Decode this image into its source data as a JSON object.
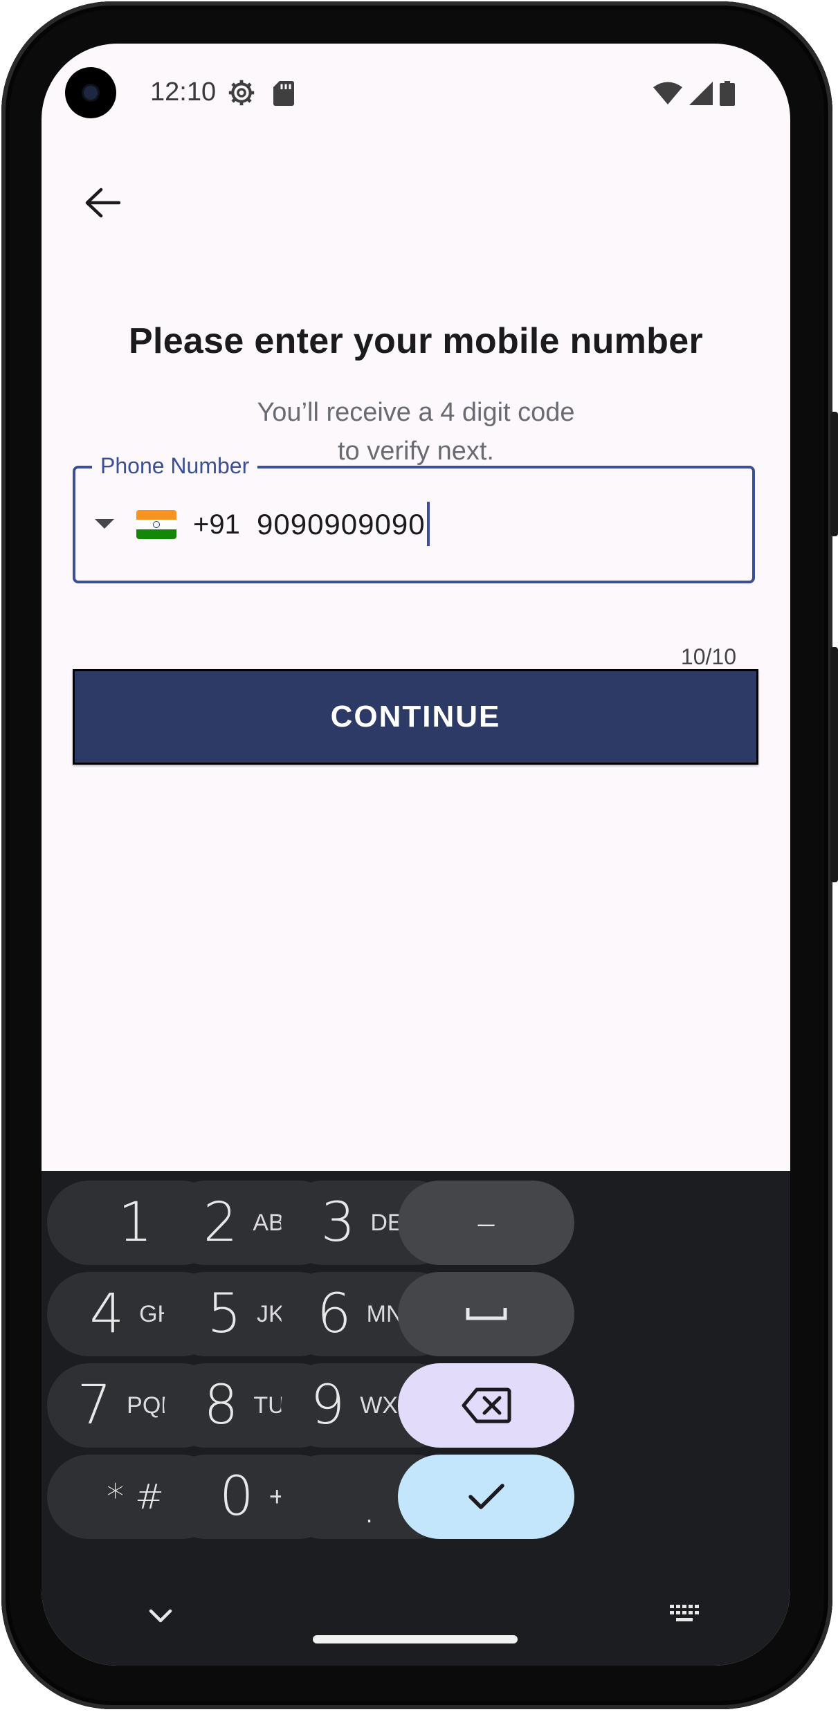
{
  "status_bar": {
    "time": "12:10"
  },
  "header": {
    "title": "Please enter your mobile number",
    "subtitle_line1": "You’ll receive a 4 digit code",
    "subtitle_line2": "to verify next."
  },
  "phone_field": {
    "label": "Phone Number",
    "dial_code": "+91",
    "value": "9090909090",
    "counter": "10/10"
  },
  "continue_button": {
    "label": "CONTINUE"
  },
  "keyboard": {
    "keys": [
      {
        "num": "1",
        "letters": ""
      },
      {
        "num": "2",
        "letters": "ABC"
      },
      {
        "num": "3",
        "letters": "DEF"
      },
      {
        "num": "4",
        "letters": "GHI"
      },
      {
        "num": "5",
        "letters": "JKL"
      },
      {
        "num": "6",
        "letters": "MNO"
      },
      {
        "num": "7",
        "letters": "PQRS"
      },
      {
        "num": "8",
        "letters": "TUV"
      },
      {
        "num": "9",
        "letters": "WXYZ"
      },
      {
        "num": "* #",
        "letters": ""
      },
      {
        "num": "0",
        "letters": "+"
      },
      {
        "num": ".",
        "letters": ""
      }
    ],
    "dash": "–",
    "icons": {
      "space": "space-icon",
      "backspace": "backspace-icon",
      "done": "check-icon",
      "hide": "chevron-down-icon",
      "switch": "keyboard-icon"
    }
  },
  "colors": {
    "accent": "#3b4f96",
    "button": "#2d3a66",
    "keyboard_bg": "#1c1d20",
    "key": "#2f3033",
    "key_fn": "#454649",
    "key_backspace": "#e3dbfa",
    "key_done": "#c4e6fd"
  }
}
